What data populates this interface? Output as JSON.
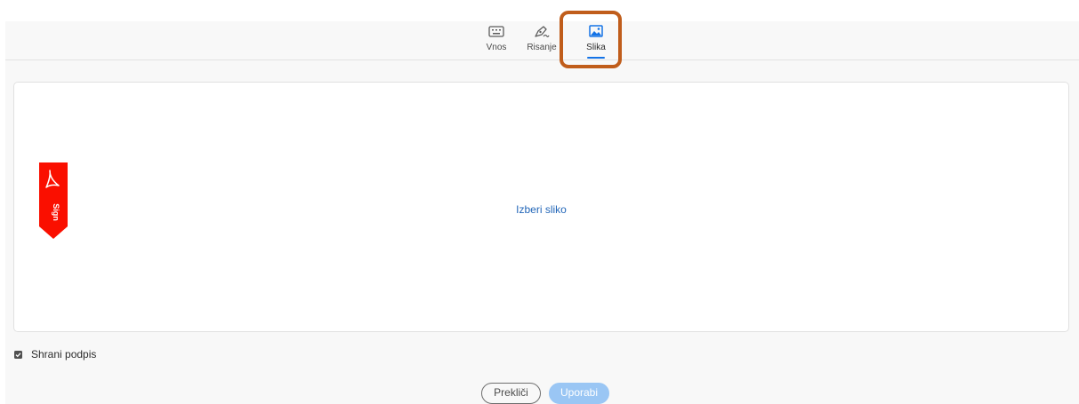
{
  "tabs": [
    {
      "label": "Vnos",
      "icon": "keyboard-icon",
      "active": false
    },
    {
      "label": "Risanje",
      "icon": "pen-draw-icon",
      "active": false
    },
    {
      "label": "Slika",
      "icon": "image-icon",
      "active": true
    }
  ],
  "image_area": {
    "choose_label": "Izberi sliko"
  },
  "ribbon": {
    "text": "Sign",
    "color": "#fa0f00"
  },
  "save_signature": {
    "label": "Shrani podpis",
    "checked": true
  },
  "buttons": {
    "cancel_label": "Prekliči",
    "apply_label": "Uporabi"
  },
  "colors": {
    "accent": "#1473e6",
    "highlight": "#c05d1b",
    "link": "#2266b8",
    "apply_disabled": "#9ac6f4"
  }
}
